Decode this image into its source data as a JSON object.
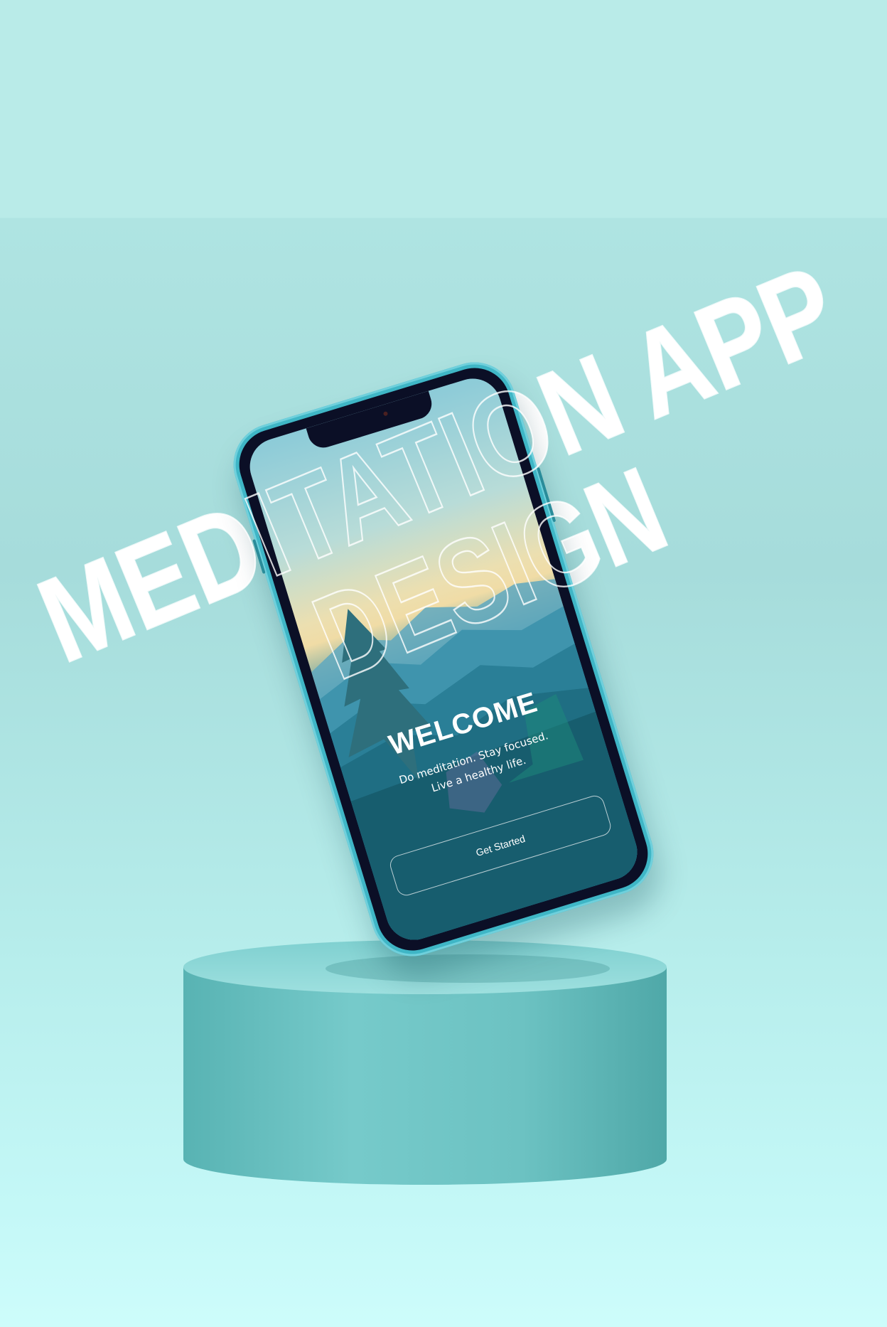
{
  "title": {
    "line1": "MEDITATION APP",
    "line2": "DESIGN"
  },
  "screen": {
    "heading": "WELCOME",
    "subtitle_line1": "Do meditation. Stay focused.",
    "subtitle_line2": "Live a healthy life.",
    "cta_label": "Get Started"
  },
  "colors": {
    "background": "#b9ebe8",
    "phone_frame": "#3fb6c6",
    "pedestal": "#6cc4c4",
    "screen_dark": "#165a6b"
  }
}
